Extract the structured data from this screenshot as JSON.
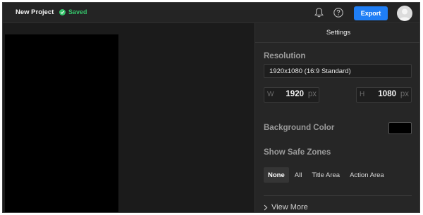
{
  "header": {
    "project_title": "New Project",
    "saved_label": "Saved",
    "export_label": "Export",
    "icons": [
      "bell-icon",
      "help-icon",
      "avatar"
    ]
  },
  "settings": {
    "title": "Settings",
    "resolution": {
      "label": "Resolution",
      "selected": "1920x1080 (16:9 Standard)",
      "width": {
        "prefix": "W",
        "value": "1920",
        "unit": "px"
      },
      "height": {
        "prefix": "H",
        "value": "1080",
        "unit": "px"
      }
    },
    "background": {
      "label": "Background Color",
      "color": "#000000"
    },
    "safe_zones": {
      "label": "Show Safe Zones",
      "options": [
        "None",
        "All",
        "Title Area",
        "Action Area"
      ],
      "selected": "None"
    },
    "view_more_label": "View More"
  },
  "colors": {
    "accent": "#1f7ef5",
    "saved": "#35c26a",
    "background": "#1c1c1c",
    "panel": "#262626"
  }
}
